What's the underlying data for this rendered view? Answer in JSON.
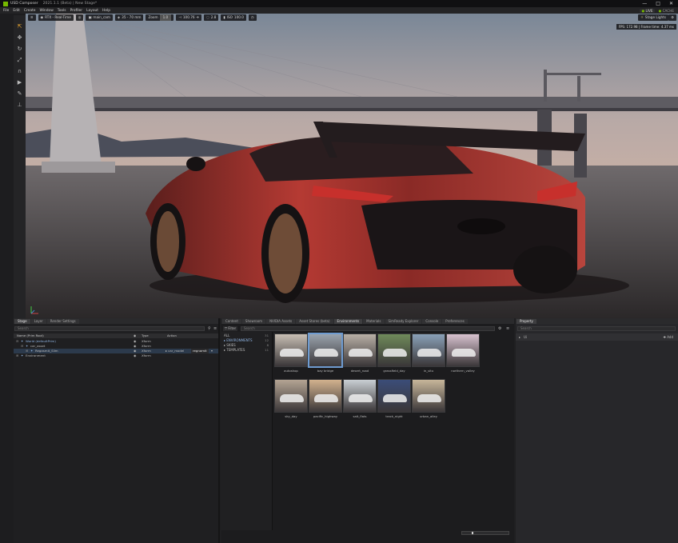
{
  "app": {
    "title": "USD Composer",
    "subtitle": "2021.1.1 (Beta) | New Stage*",
    "window_controls": [
      "—",
      "□",
      "✕"
    ]
  },
  "menu": {
    "items": [
      "File",
      "Edit",
      "Create",
      "Window",
      "Tools",
      "Profiler",
      "Layout",
      "Help"
    ],
    "live_label": "LIVE",
    "cache_label": "CACHE"
  },
  "viewport": {
    "renderer": "RTX - Real-Time",
    "camera": "main_cam",
    "lens": "35 - 70 mm",
    "zoom_label": "Zoom",
    "zoom_value": "1.0",
    "focus_value": "100.76",
    "fstop_value": "2.8",
    "iso_label": "ISO",
    "iso_value": "100.0",
    "stage_lights": "Stage Lights",
    "fps_text": "FPS: 172.98 | Frame time: 4.37 ms"
  },
  "stage": {
    "tabs": [
      "Stage",
      "Layer",
      "Render Settings"
    ],
    "search_placeholder": "Search",
    "columns": [
      "Name (Prim Root)",
      "Type",
      "Action"
    ],
    "rows": [
      {
        "name": "World (defaultPrim)",
        "type": "Xform",
        "action": "",
        "variant": ""
      },
      {
        "name": "car_asset",
        "type": "Xform",
        "action": "",
        "variant": ""
      },
      {
        "name": "Regasmit_Slim",
        "type": "Xform",
        "action": "▸ car_model",
        "variant": "regnamit"
      },
      {
        "name": "Environment",
        "type": "Xform",
        "action": "",
        "variant": ""
      }
    ]
  },
  "content": {
    "tabs": [
      "Content",
      "Showroom",
      "NVIDIA Assets",
      "Asset Stores (beta)",
      "Environments",
      "Materials",
      "SimReady Explorer",
      "Console",
      "Preferences"
    ],
    "active_tab": "Environments",
    "filter_label": "Filter",
    "search_placeholder": "Search",
    "tree": [
      {
        "label": "ALL",
        "count": "31"
      },
      {
        "label": "ENVIRONMENTS",
        "count": "12"
      },
      {
        "label": "SKIES",
        "count": "8"
      },
      {
        "label": "TEMPLATES",
        "count": "11"
      }
    ],
    "thumbnails": [
      {
        "label": "autoshop",
        "bg": "#c8bfb4"
      },
      {
        "label": "bay bridge",
        "bg": "#9aa3ad"
      },
      {
        "label": "desert_road",
        "bg": "#b9b0a6"
      },
      {
        "label": "grassfield_day",
        "bg": "#6f8a5a"
      },
      {
        "label": "in_situ",
        "bg": "#8aa1b8"
      },
      {
        "label": "northern_valley",
        "bg": "#d8c2cf"
      },
      {
        "label": "sky_day",
        "bg": "#b4a493"
      },
      {
        "label": "pacific_highway",
        "bg": "#d2b28e"
      },
      {
        "label": "salt_flats",
        "bg": "#c9cfd3"
      },
      {
        "label": "track_night",
        "bg": "#3b4d78"
      },
      {
        "label": "urban_alley",
        "bg": "#c7b69a"
      }
    ]
  },
  "property": {
    "tab": "Property",
    "search_placeholder": "Search",
    "add_label": "Add",
    "section_label": "Ui"
  },
  "colors": {
    "accent": "#76b900",
    "selection": "#6e9bd0"
  }
}
